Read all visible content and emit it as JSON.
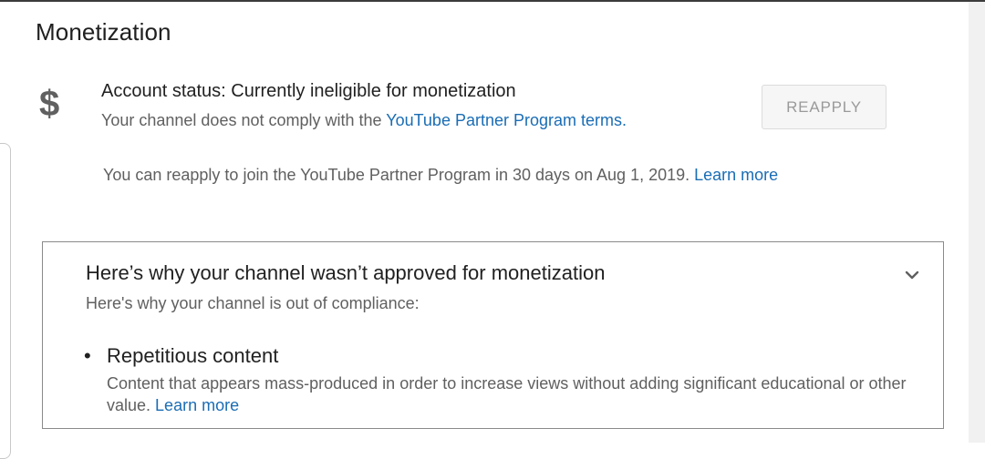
{
  "monetization": {
    "title": "Monetization",
    "icon": "dollar-icon",
    "status": "Account status: Currently ineligible for monetization",
    "sub_prefix": "Your channel does not comply with the ",
    "terms_link": "YouTube Partner Program terms.",
    "reapply_label": "REAPPLY",
    "reapply_note_prefix": "You can reapply to join the YouTube Partner Program in 30 days on Aug 1, 2019. ",
    "learn_more": "Learn more"
  },
  "reasons": {
    "title": "Here’s why your channel wasn’t approved for monetization",
    "subtitle": "Here's why your channel is out of compliance:",
    "expand_icon": "chevron-down-icon",
    "items": [
      {
        "title": "Repetitious content",
        "desc_prefix": "Content that appears mass-produced in order to increase views without adding significant educational or other value. ",
        "learn_more": "Learn more"
      }
    ]
  }
}
